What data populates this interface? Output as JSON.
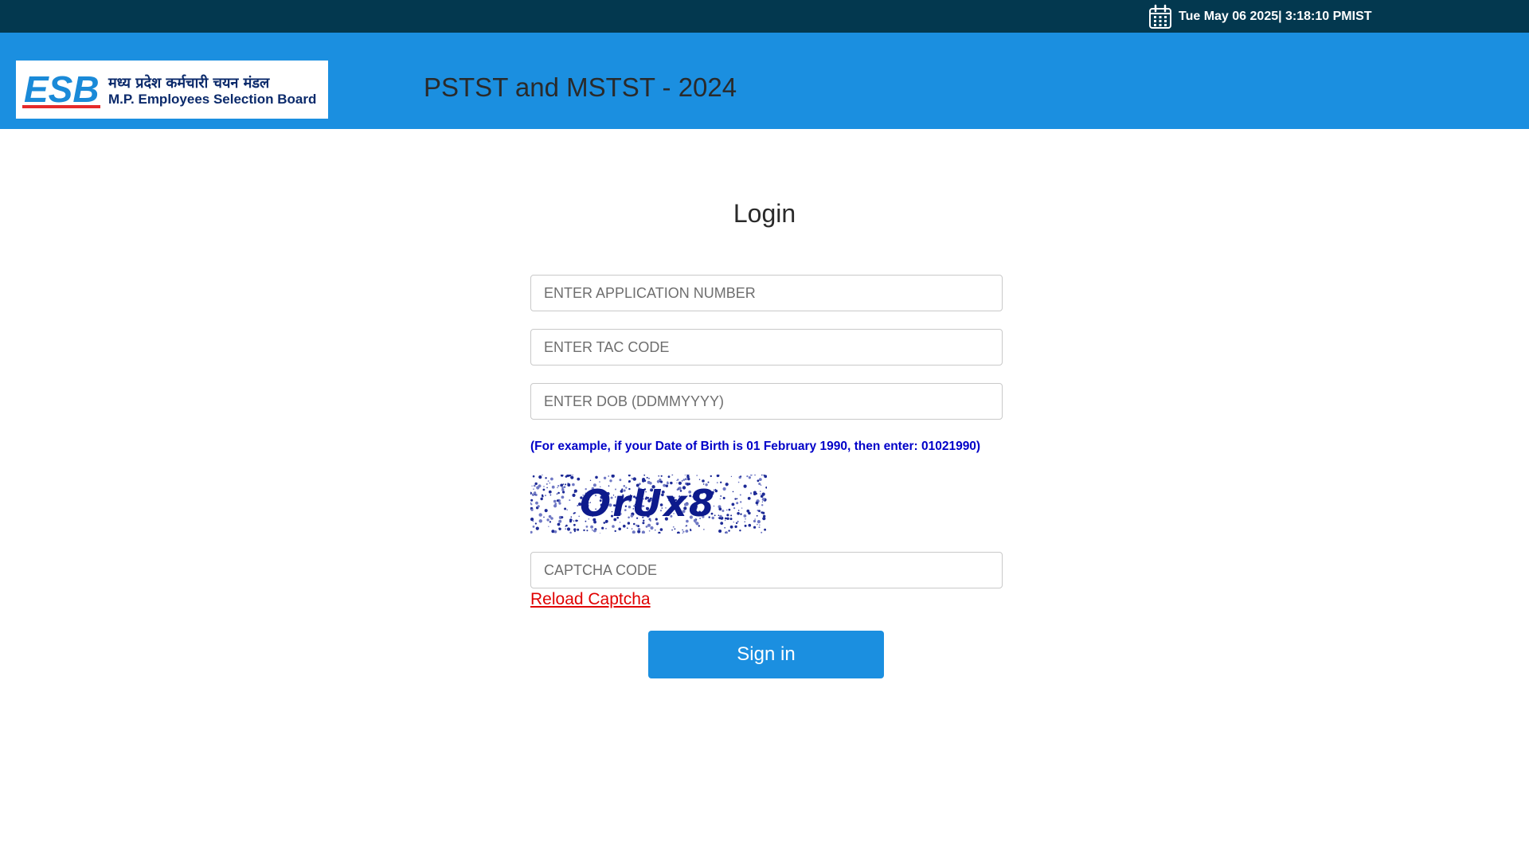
{
  "topbar": {
    "datetime": "Tue May 06 2025| 3:18:10 PMIST",
    "icon": "calendar-icon"
  },
  "header": {
    "logo": {
      "abbr": "ESB",
      "hindi_name": "मध्य प्रदेश कर्मचारी चयन मंडल",
      "english_name": "M.P. Employees Selection Board"
    },
    "title": "PSTST and MSTST - 2024"
  },
  "login": {
    "title": "Login",
    "application_number": {
      "placeholder": "ENTER APPLICATION NUMBER",
      "value": ""
    },
    "tac_code": {
      "placeholder": "ENTER TAC CODE",
      "value": ""
    },
    "dob": {
      "placeholder": "ENTER DOB (DDMMYYYY)",
      "value": ""
    },
    "dob_hint": "(For example, if your Date of Birth is 01 February 1990, then enter: 01021990)",
    "captcha_text": "OrUx8",
    "captcha_field": {
      "placeholder": "CAPTCHA CODE",
      "value": ""
    },
    "reload_label": "Reload Captcha",
    "signin_label": "Sign in"
  },
  "colors": {
    "topbar_bg": "#03384f",
    "header_bg": "#1b8fe0",
    "button_bg": "#1b8fe0",
    "hint_text": "#0000c8",
    "reload_link": "#e00000"
  }
}
